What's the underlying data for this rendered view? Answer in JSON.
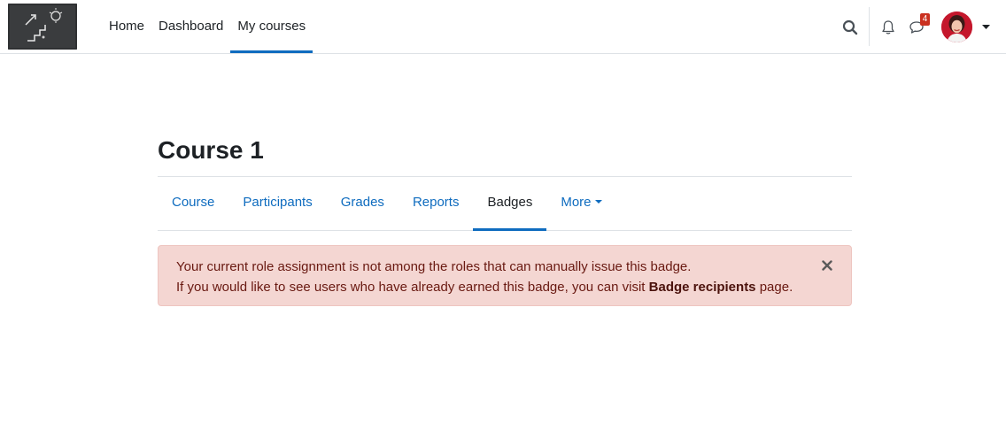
{
  "navbar": {
    "logo_alt": "Site logo",
    "items": [
      {
        "label": "Home",
        "active": false
      },
      {
        "label": "Dashboard",
        "active": false
      },
      {
        "label": "My courses",
        "active": true
      }
    ],
    "icons": {
      "search": "search-icon",
      "notifications": "bell-icon",
      "messages": "chat-icon",
      "user_menu": "caret-down-icon"
    },
    "messages_count": "4",
    "accent_color": "#0f6cbf",
    "badge_color": "#ca3120"
  },
  "page": {
    "title": "Course 1"
  },
  "secondary_nav": {
    "tabs": [
      {
        "label": "Course",
        "active": false
      },
      {
        "label": "Participants",
        "active": false
      },
      {
        "label": "Grades",
        "active": false
      },
      {
        "label": "Reports",
        "active": false
      },
      {
        "label": "Badges",
        "active": true
      },
      {
        "label": "More",
        "active": false,
        "dropdown": true
      }
    ]
  },
  "alert": {
    "line1": "Your current role assignment is not among the roles that can manually issue this badge.",
    "line2_prefix": "If you would like to see users who have already earned this badge, you can visit ",
    "line2_link": "Badge recipients",
    "line2_suffix": " page.",
    "close_icon": "close-icon",
    "background": "#f4d6d2",
    "text_color": "#691911"
  }
}
